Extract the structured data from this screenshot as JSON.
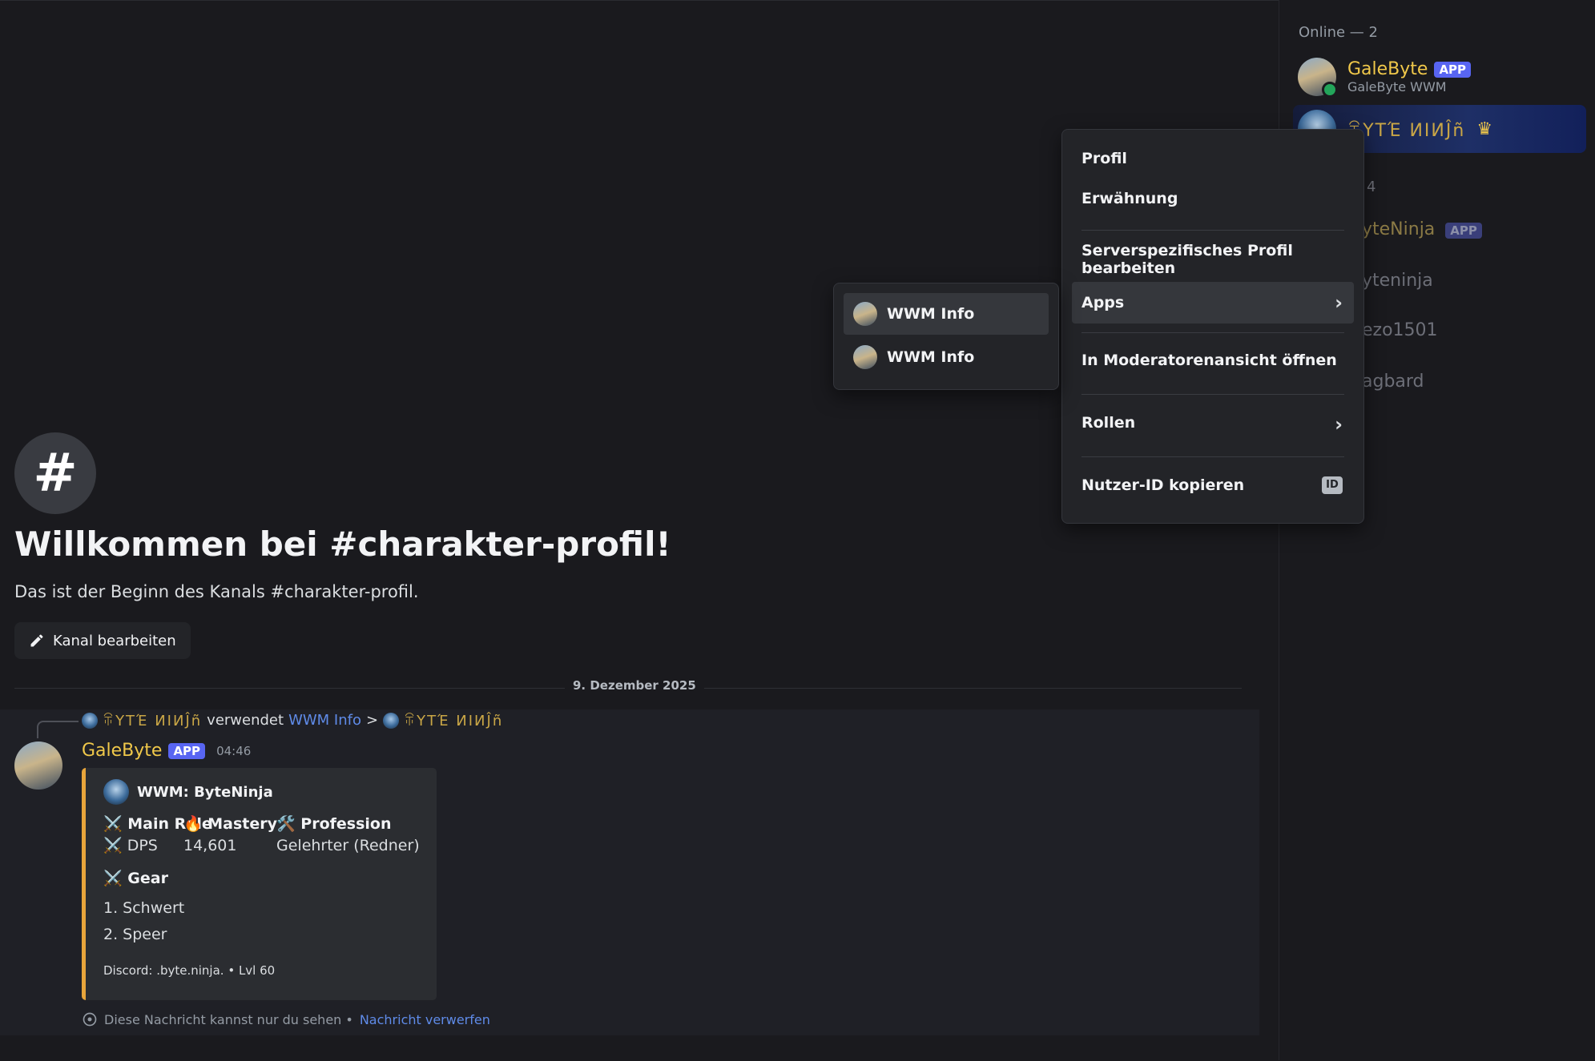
{
  "channel": {
    "hash_symbol": "#",
    "welcome_title": "Willkommen bei #charakter-profil!",
    "welcome_subtitle": "Das ist der Beginn des Kanals #charakter-profil.",
    "edit_button": "Kanal bearbeiten",
    "date_divider": "9. Dezember 2025"
  },
  "message": {
    "reply": {
      "user": "ꋖΥTΈ ИIИĴñ",
      "verb": "verwendet",
      "app": "WWM Info",
      "arrow": ">",
      "target": "ꋖΥTΈ ИIИĴñ"
    },
    "author": "GaleByte",
    "badge": "APP",
    "time": "04:46",
    "embed": {
      "author": "WWM: ByteNinja",
      "fields": [
        {
          "name": "⚔️ Main Role",
          "value": "⚔️ DPS"
        },
        {
          "name": "🔥 Mastery",
          "value": "14,601"
        },
        {
          "name": "🛠️ Profession",
          "value": "Gelehrter (Redner)"
        }
      ],
      "gear_title": "⚔️ Gear",
      "gear_items": [
        "1. Schwert",
        "2. Speer"
      ],
      "footer": "Discord: .byte.ninja. • Lvl 60"
    },
    "ephemeral_text": "Diese Nachricht kannst nur du sehen •",
    "dismiss_link": "Nachricht verwerfen"
  },
  "members": {
    "online_header": "Online — 2",
    "online": [
      {
        "name": "GaleByte",
        "badge": "APP",
        "subtitle": "GaleByte WWM",
        "color": "#f0c84a"
      },
      {
        "name": "ꋖΥTΈ ИIИĴñ",
        "crown": "♛",
        "color": "#c9a646"
      }
    ],
    "offline_header_fragment": "4",
    "offline": [
      {
        "name_fragment": "yteNinja",
        "badge": "APP"
      },
      {
        "name_fragment": "yteninja"
      },
      {
        "name_fragment": "ezo1501"
      },
      {
        "name_fragment": "agbard"
      }
    ]
  },
  "context_menu": {
    "items": [
      {
        "label": "Profil"
      },
      {
        "label": "Erwähnung"
      },
      {
        "label": "Serverspezifisches Profil bearbeiten"
      },
      {
        "label": "Apps",
        "chevron": "›"
      },
      {
        "label": "In Moderatorenansicht öffnen"
      },
      {
        "label": "Rollen",
        "chevron": "›"
      },
      {
        "label": "Nutzer-ID kopieren",
        "badge": "ID"
      }
    ]
  },
  "apps_submenu": {
    "items": [
      {
        "label": "WWM Info"
      },
      {
        "label": "WWM Info"
      }
    ]
  },
  "colors": {
    "background": "#1a1a1e",
    "accent": "#5865f2",
    "embed_bar": "#e8a53b",
    "link": "#5f8be8",
    "online_status": "#23a55a"
  }
}
